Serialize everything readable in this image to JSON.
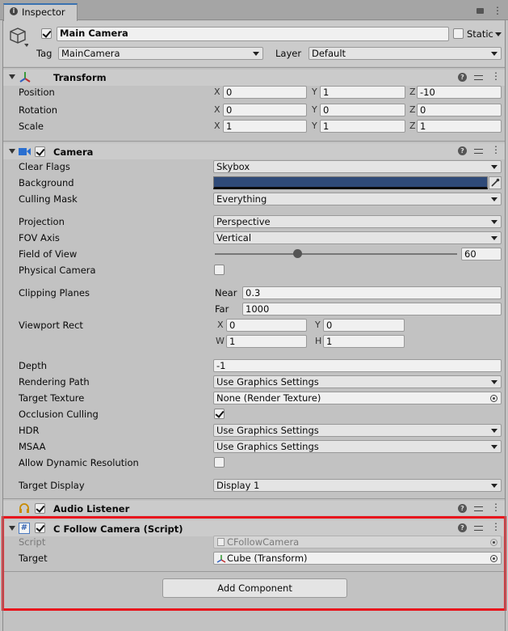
{
  "tab": {
    "label": "Inspector"
  },
  "object": {
    "name": "Main Camera",
    "static_label": "Static",
    "tag_label": "Tag",
    "tag_value": "MainCamera",
    "layer_label": "Layer",
    "layer_value": "Default"
  },
  "transform": {
    "title": "Transform",
    "position": {
      "label": "Position",
      "x": "0",
      "y": "1",
      "z": "-10"
    },
    "rotation": {
      "label": "Rotation",
      "x": "0",
      "y": "0",
      "z": "0"
    },
    "scale": {
      "label": "Scale",
      "x": "1",
      "y": "1",
      "z": "1"
    },
    "axis": {
      "x": "X",
      "y": "Y",
      "z": "Z"
    }
  },
  "camera": {
    "title": "Camera",
    "clear_flags": {
      "label": "Clear Flags",
      "value": "Skybox"
    },
    "background": {
      "label": "Background",
      "color": "#2f4a78"
    },
    "culling_mask": {
      "label": "Culling Mask",
      "value": "Everything"
    },
    "projection": {
      "label": "Projection",
      "value": "Perspective"
    },
    "fov_axis": {
      "label": "FOV Axis",
      "value": "Vertical"
    },
    "field_of_view": {
      "label": "Field of View",
      "value": "60",
      "slider_fraction": 0.34
    },
    "physical_camera": {
      "label": "Physical Camera"
    },
    "clipping": {
      "label": "Clipping Planes",
      "near_label": "Near",
      "near": "0.3",
      "far_label": "Far",
      "far": "1000"
    },
    "viewport": {
      "label": "Viewport Rect",
      "x_label": "X",
      "x": "0",
      "y_label": "Y",
      "y": "0",
      "w_label": "W",
      "w": "1",
      "h_label": "H",
      "h": "1"
    },
    "depth": {
      "label": "Depth",
      "value": "-1"
    },
    "rendering_path": {
      "label": "Rendering Path",
      "value": "Use Graphics Settings"
    },
    "target_texture": {
      "label": "Target Texture",
      "value": "None (Render Texture)"
    },
    "occlusion": {
      "label": "Occlusion Culling"
    },
    "hdr": {
      "label": "HDR",
      "value": "Use Graphics Settings"
    },
    "msaa": {
      "label": "MSAA",
      "value": "Use Graphics Settings"
    },
    "dynamic_res": {
      "label": "Allow Dynamic Resolution"
    },
    "target_display": {
      "label": "Target Display",
      "value": "Display 1"
    }
  },
  "audio_listener": {
    "title": "Audio Listener"
  },
  "script_comp": {
    "title": "C Follow Camera (Script)",
    "script_label": "Script",
    "script_value": "CFollowCamera",
    "target_label": "Target",
    "target_value": "Cube (Transform)"
  },
  "add_component": {
    "label": "Add Component"
  },
  "colors": {
    "highlight": "#e8141c",
    "panel": "#c2c2c2"
  }
}
